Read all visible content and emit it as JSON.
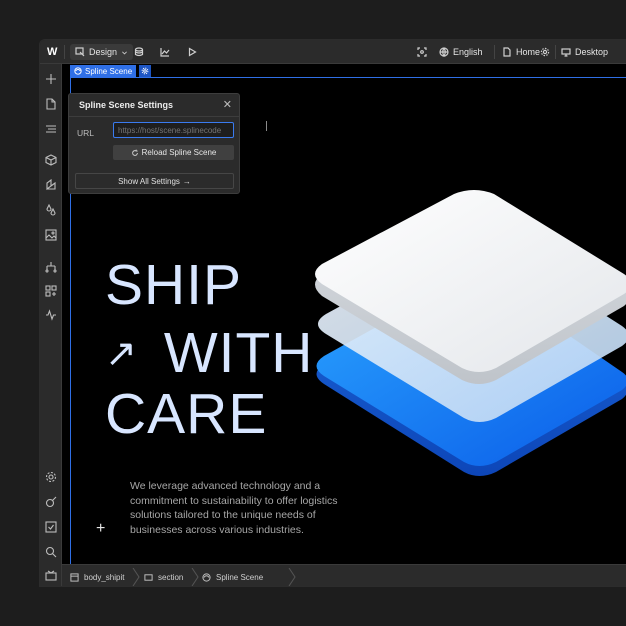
{
  "topbar": {
    "logo": "W",
    "mode_label": "Design",
    "language": "English",
    "page": "Home",
    "breakpoint": "Desktop"
  },
  "selection": {
    "chip_label": "Spline Scene"
  },
  "popup": {
    "title": "Spline Scene Settings",
    "url_label": "URL",
    "url_placeholder": "https://host/scene.splinecode",
    "reload_label": "Reload Spline Scene",
    "show_all_label": "Show All Settings",
    "show_all_arrow": "→"
  },
  "canvas": {
    "headline_1": "SHIP",
    "headline_arrow": "↗",
    "headline_2": "WITH",
    "headline_3": "CARE",
    "paragraph": "We leverage advanced technology and a commitment to sustainability to offer logistics solutions tailored to the unique needs of businesses across various industries.",
    "plus": "+"
  },
  "breadcrumb": [
    {
      "label": "body_shipit"
    },
    {
      "label": "section"
    },
    {
      "label": "Spline Scene"
    }
  ],
  "colors": {
    "accent": "#2f6fe6",
    "headline": "#d8e6ff",
    "canvas_bg": "#000000"
  }
}
